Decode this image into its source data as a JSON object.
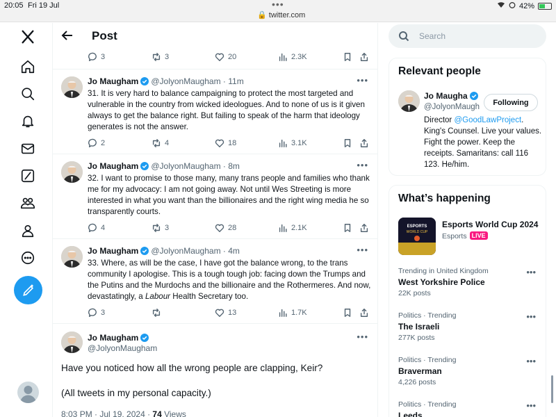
{
  "status_bar": {
    "time": "20:05",
    "date": "Fri 19 Jul",
    "url": "twitter.com",
    "battery": "42%"
  },
  "header": {
    "title": "Post"
  },
  "top_actions": {
    "replies": "3",
    "reposts": "3",
    "likes": "20",
    "views": "2.3K"
  },
  "tweets": [
    {
      "name": "Jo Maugham",
      "handle": "@JolyonMaugham",
      "time": "11m",
      "text": "31. It is very hard to balance campaigning to protect the most targeted and vulnerable in the country from wicked ideologues. And to none of us is it given always to get the balance right. But failing to speak of the harm that ideology generates is not the answer.",
      "replies": "2",
      "reposts": "4",
      "likes": "18",
      "views": "3.1K"
    },
    {
      "name": "Jo Maugham",
      "handle": "@JolyonMaugham",
      "time": "8m",
      "text": "32. I want to promise to those many, many trans people and families who thank me for my advocacy:  I am not going away. Not until Wes Streeting is more interested in  what you want than the billionaires and the right wing media he so transparently courts.",
      "replies": "4",
      "reposts": "3",
      "likes": "28",
      "views": "2.1K"
    },
    {
      "name": "Jo Maugham",
      "handle": "@JolyonMaugham",
      "time": "4m",
      "text_before": "33. Where, as will be the case, I have got the balance wrong, to the trans community I apologise. This is a tough tough job: facing down the Trumps and the Putins and the Murdochs and the billionaire and the Rothermeres. And now, devastatingly, a ",
      "text_italic": "Labour",
      "text_after": " Health Secretary too.",
      "replies": "3",
      "reposts": "",
      "likes": "13",
      "views": "1.7K"
    }
  ],
  "main_tweet": {
    "name": "Jo Maugham",
    "handle": "@JolyonMaugham",
    "text1": "Have you noticed how all the wrong people are clapping, Keir?",
    "text2": "(All tweets in my personal capacity.)",
    "timestamp": "8:03 PM · Jul 19, 2024 · ",
    "views_count": "74",
    "views_label": " Views"
  },
  "search": {
    "placeholder": "Search"
  },
  "relevant": {
    "title": "Relevant people",
    "name": "Jo Maugha",
    "handle": "@JolyonMaugh",
    "follow_label": "Following",
    "bio_before": "Director ",
    "bio_link": "@GoodLawProject",
    "bio_after": ". King's Counsel. Live your values. Fight the power. Keep the receipts. Samaritans: call 116 123. He/him."
  },
  "happening": {
    "title": "What’s happening",
    "event": {
      "title": "Esports World Cup 2024",
      "category": "Esports",
      "live": "LIVE"
    },
    "trends": [
      {
        "category": "Trending in United Kingdom",
        "title": "West Yorkshire Police",
        "count": "22K posts"
      },
      {
        "category": "Politics · Trending",
        "title": "The Israeli",
        "count": "277K posts"
      },
      {
        "category": "Politics · Trending",
        "title": "Braverman",
        "count": "4,226 posts"
      },
      {
        "category": "Politics · Trending",
        "title": "Leeds",
        "count": ""
      }
    ]
  },
  "colors": {
    "accent": "#1d9bf0",
    "live": "#f91880",
    "text": "#0f1419",
    "muted": "#536471"
  },
  "icons": [
    "x-logo-icon",
    "home-icon",
    "search-icon",
    "bell-icon",
    "mail-icon",
    "grok-icon",
    "communities-icon",
    "profile-icon",
    "more-icon",
    "compose-icon",
    "back-icon",
    "reply-icon",
    "repost-icon",
    "like-icon",
    "views-icon",
    "bookmark-icon",
    "share-icon",
    "verified-icon",
    "more-dots-icon"
  ]
}
